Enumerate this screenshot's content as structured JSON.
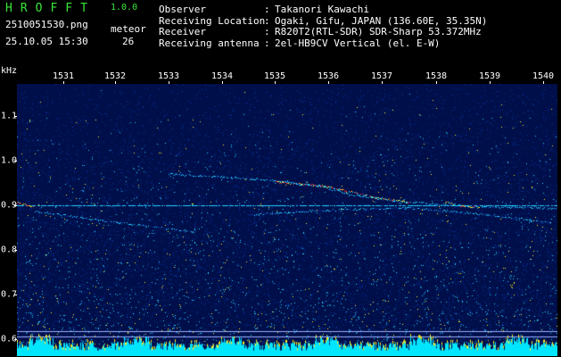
{
  "header": {
    "brand": "HROFFT",
    "version": "1.0.0",
    "filename": "2510051530.png",
    "datetime": "25.10.05 15:30",
    "meteor_label": "meteor",
    "meteor_count": "26"
  },
  "metadata": [
    {
      "key": "Observer",
      "value": "Takanori Kawachi"
    },
    {
      "key": "Receiving Location",
      "value": "Ogaki, Gifu, JAPAN (136.60E, 35.35N)"
    },
    {
      "key": "Receiver",
      "value": "R820T2(RTL-SDR) SDR-Sharp 53.372MHz"
    },
    {
      "key": "Receiving antenna",
      "value": "2el-HB9CV Vertical (el. E-W)"
    }
  ],
  "axes": {
    "y_unit": "kHz",
    "x_ticks": [
      "1531",
      "1532",
      "1533",
      "1534",
      "1535",
      "1536",
      "1537",
      "1538",
      "1539",
      "1540"
    ],
    "y_ticks": [
      "1.1",
      "1.0",
      "0.9",
      "0.8",
      "0.7",
      "0.6"
    ]
  },
  "colors": {
    "background": "#000000",
    "title_green": "#39e639",
    "noise_deep": "#000f4a",
    "noise_mid": "#0a2f9a",
    "signal_cyan": "#25d0ff",
    "signal_yellow": "#ffee20",
    "signal_red": "#ff3030",
    "power_bar": "#00e6ff"
  }
}
